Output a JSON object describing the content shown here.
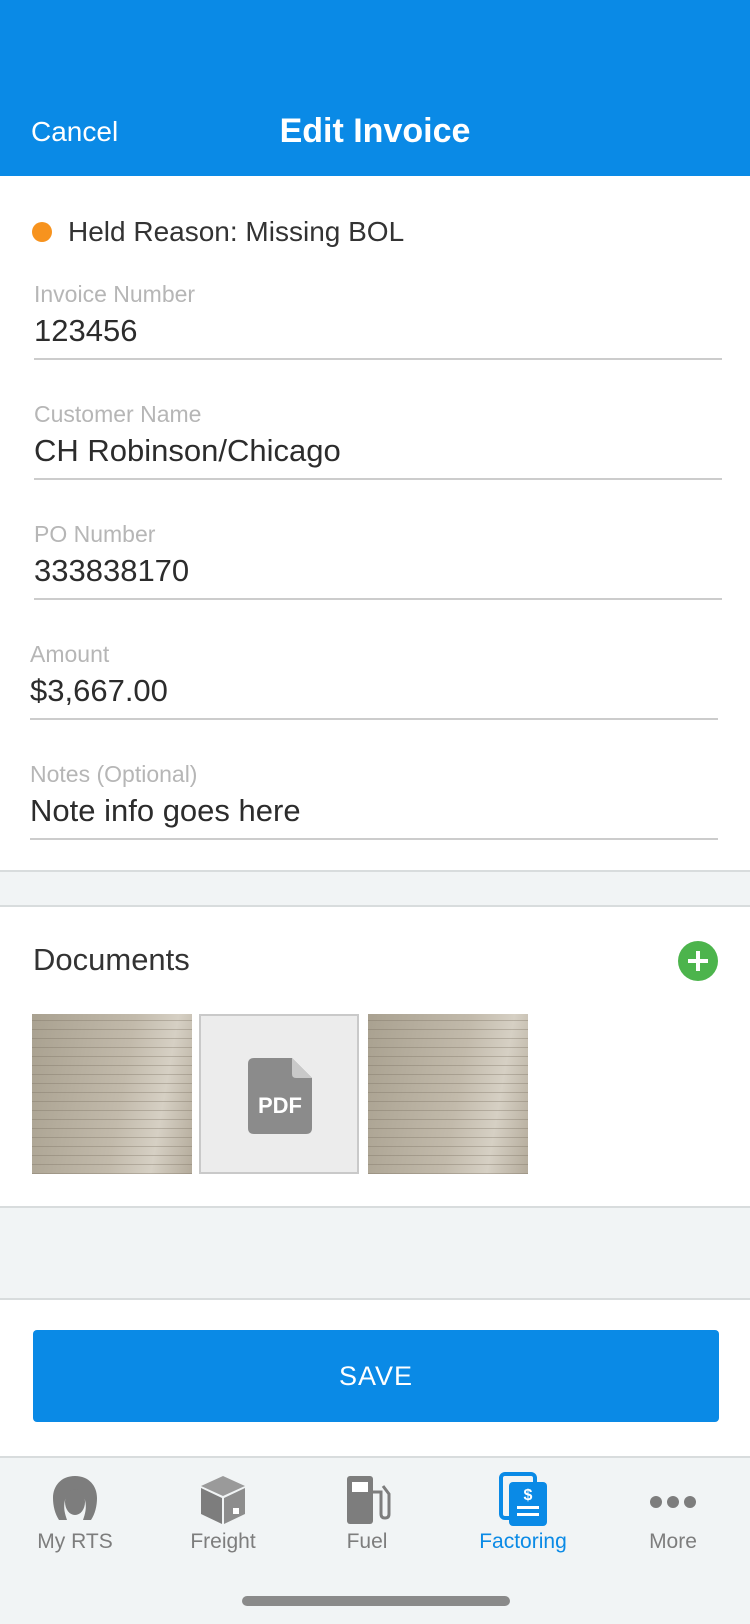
{
  "header": {
    "cancel_label": "Cancel",
    "title": "Edit Invoice",
    "bg_color": "#0a8ae6"
  },
  "held": {
    "text": "Held Reason: Missing BOL",
    "status_color": "#f7931e"
  },
  "form": {
    "invoice_number": {
      "label": "Invoice Number",
      "value": "123456"
    },
    "customer_name": {
      "label": "Customer Name",
      "value": "CH Robinson/Chicago"
    },
    "po_number": {
      "label": "PO Number",
      "value": "333838170"
    },
    "amount": {
      "label": "Amount",
      "value": "$3,667.00"
    },
    "notes": {
      "label": "Notes (Optional)",
      "value": "Note info goes here"
    }
  },
  "documents": {
    "title": "Documents",
    "add_icon": "plus-circle-icon",
    "items": [
      {
        "type": "photo"
      },
      {
        "type": "pdf",
        "icon_text": "PDF"
      },
      {
        "type": "photo"
      }
    ]
  },
  "save_button": {
    "label": "SAVE"
  },
  "tabbar": {
    "items": [
      {
        "label": "My RTS",
        "icon": "user-icon",
        "active": false
      },
      {
        "label": "Freight",
        "icon": "package-icon",
        "active": false
      },
      {
        "label": "Fuel",
        "icon": "fuel-pump-icon",
        "active": false
      },
      {
        "label": "Factoring",
        "icon": "invoice-dollar-icon",
        "active": true
      },
      {
        "label": "More",
        "icon": "more-dots-icon",
        "active": false
      }
    ],
    "active_color": "#0a8ae6",
    "inactive_color": "#7d7d7d"
  }
}
